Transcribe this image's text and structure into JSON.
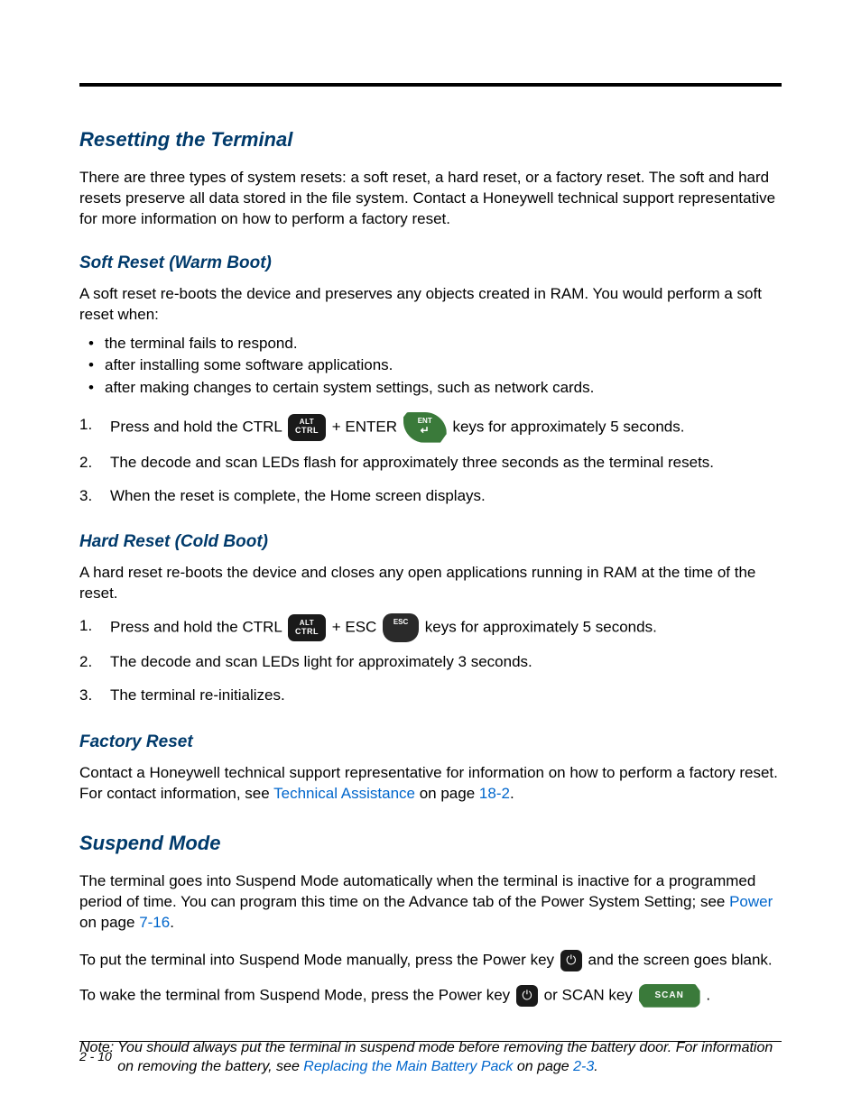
{
  "h1_reset": "Resetting the Terminal",
  "p_reset_intro": "There are three types of system resets: a soft reset, a hard reset, or a factory reset. The soft and hard resets preserve all data stored in the file system. Contact a Honeywell technical support representative for more information on how to perform a factory reset.",
  "h2_soft": "Soft Reset (Warm Boot)",
  "p_soft_intro": "A soft reset re-boots the device and preserves any objects created in RAM. You would perform a soft reset when:",
  "soft_bullets": {
    "0": "the terminal fails to respond.",
    "1": "after installing some software applications.",
    "2": "after making changes to certain system settings, such as network cards."
  },
  "soft_steps": {
    "0": {
      "num": "1.",
      "pre": "Press and hold the CTRL ",
      "mid": " + ENTER ",
      "post": " keys for approximately 5 seconds."
    },
    "1": {
      "num": "2.",
      "text": "The decode and scan LEDs flash for approximately three seconds as the terminal resets."
    },
    "2": {
      "num": "3.",
      "text": "When the reset is complete, the Home screen displays."
    }
  },
  "h2_hard": "Hard Reset (Cold Boot)",
  "p_hard_intro": "A hard reset re-boots the device and closes any open applications running in RAM at the time of the reset.",
  "hard_steps": {
    "0": {
      "num": "1.",
      "pre": "Press and hold the CTRL ",
      "mid": " + ESC ",
      "post": " keys for approximately 5 seconds."
    },
    "1": {
      "num": "2.",
      "text": "The decode and scan LEDs light for approximately 3 seconds."
    },
    "2": {
      "num": "3.",
      "text": "The terminal re-initializes."
    }
  },
  "h2_factory": "Factory Reset",
  "p_factory_1": "Contact a Honeywell technical support representative for information on how to perform a factory reset. For contact information, see ",
  "link_tech": "Technical Assistance",
  "p_factory_2": " on page ",
  "link_18_2": "18-2",
  "p_factory_3": ".",
  "h1_suspend": "Suspend Mode",
  "p_suspend_1a": "The terminal goes into Suspend Mode automatically when the terminal is inactive for a programmed period of time. You can program this time on the Advance tab of the Power System Setting; see ",
  "link_power": "Power",
  "p_suspend_1b": " on page ",
  "link_7_16": "7-16",
  "p_suspend_1c": ".",
  "p_suspend_2a": "To put the terminal into Suspend Mode manually, press the Power key ",
  "p_suspend_2b": " and the screen goes blank.",
  "p_suspend_3a": "To wake the terminal from Suspend Mode, press the Power key ",
  "p_suspend_3b": " or SCAN key ",
  "p_suspend_3c": " .",
  "note_label": "Note:",
  "note_a": "You should always put the terminal in suspend mode before removing the battery door. For information on removing the battery, see ",
  "link_replace": "Replacing the Main Battery Pack",
  "note_b": " on page ",
  "link_2_3": "2-3",
  "note_c": ".",
  "keys": {
    "ctrl_top": "ALT",
    "ctrl_bot": "CTRL",
    "ent": "ENT",
    "ent_arrow": "↵",
    "esc": "ESC",
    "scan": "SCAN"
  },
  "page_number": "2 - 10"
}
